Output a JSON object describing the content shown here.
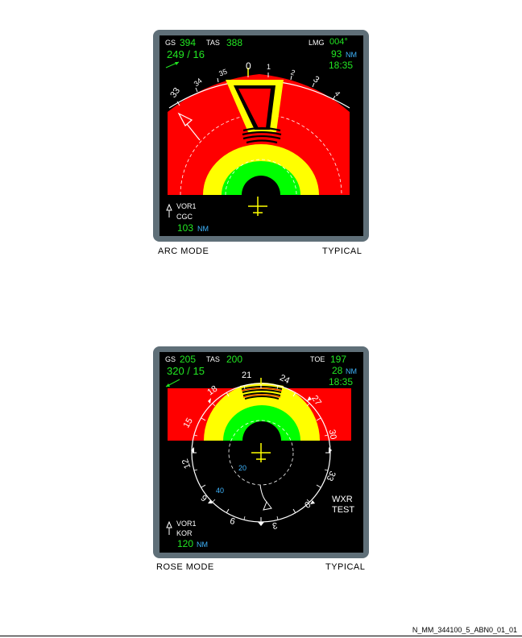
{
  "arc": {
    "gs_label": "GS",
    "gs_value": "394",
    "tas_label": "TAS",
    "tas_value": "388",
    "wind": "249 / 16",
    "wpt_label": "LMG",
    "wpt_track": "004°",
    "wpt_dist": "93",
    "wpt_dist_unit": "NM",
    "wpt_time": "18:35",
    "scale": [
      "33",
      "34",
      "35",
      "0",
      "1",
      "2",
      "3",
      "4"
    ],
    "nav_label": "VOR1",
    "nav_id": "CGC",
    "nav_dist": "103",
    "nav_unit": "NM",
    "caption_left": "ARC MODE",
    "caption_right": "TYPICAL"
  },
  "rose": {
    "gs_label": "GS",
    "gs_value": "205",
    "tas_label": "TAS",
    "tas_value": "200",
    "wind": "320 / 15",
    "wpt_label": "TOE",
    "wpt_track": "197",
    "wpt_dist": "28",
    "wpt_dist_unit": "NM",
    "wpt_time": "18:35",
    "scale": [
      "21",
      "24",
      "18",
      "27",
      "15",
      "30",
      "12",
      "33",
      "6",
      "0",
      "9",
      "3"
    ],
    "range_inner": "20",
    "range_outer": "40",
    "wxr_line1": "WXR",
    "wxr_line2": "TEST",
    "nav_label": "VOR1",
    "nav_id": "KOR",
    "nav_dist": "120",
    "nav_unit": "NM",
    "caption_left": "ROSE MODE",
    "caption_right": "TYPICAL"
  },
  "footer_ref": "N_MM_344100_5_ABN0_01_01",
  "colors": {
    "bezel": "#5f6f78",
    "red": "#ff0000",
    "yellow": "#ffff00",
    "green": "#00ff00",
    "magenta": "#ff00ff",
    "text_green": "#22e622",
    "text_cyan": "#3fb6ff"
  }
}
